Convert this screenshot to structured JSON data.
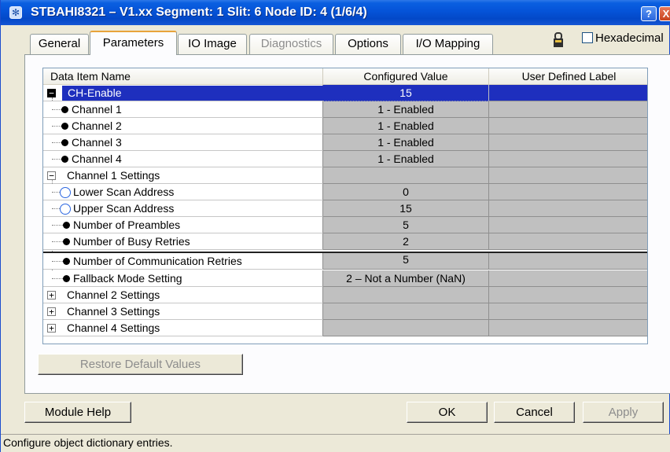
{
  "window": {
    "title": "STBAHI8321 – V1.xx Segment: 1 Slit: 6 Node ID: 4 (1/6/4)",
    "help_glyph": "?",
    "close_glyph": "X"
  },
  "tabs": [
    {
      "label": "General",
      "state": "normal"
    },
    {
      "label": "Parameters",
      "state": "active"
    },
    {
      "label": "IO Image",
      "state": "normal"
    },
    {
      "label": "Diagnostics",
      "state": "disabled"
    },
    {
      "label": "Options",
      "state": "normal"
    },
    {
      "label": "I/O Mapping",
      "state": "normal"
    }
  ],
  "hexadecimal": {
    "label": "Hexadecimal",
    "checked": false
  },
  "grid": {
    "columns": [
      "Data Item Name",
      "Configured Value",
      "User Defined Label"
    ],
    "rows": [
      {
        "name": "CH-Enable",
        "value": "15",
        "label": "",
        "kind": "group",
        "expanded": true,
        "selected": true
      },
      {
        "name": "Channel 1",
        "value": "1 - Enabled",
        "label": "",
        "kind": "item"
      },
      {
        "name": "Channel 2",
        "value": "1 - Enabled",
        "label": "",
        "kind": "item"
      },
      {
        "name": "Channel 3",
        "value": "1 - Enabled",
        "label": "",
        "kind": "item"
      },
      {
        "name": "Channel 4",
        "value": "1 - Enabled",
        "label": "",
        "kind": "item"
      },
      {
        "name": "Channel 1 Settings",
        "value": "",
        "label": "",
        "kind": "group",
        "expanded": true
      },
      {
        "name": "Lower Scan Address",
        "value": "0",
        "label": "",
        "kind": "ring"
      },
      {
        "name": "Upper Scan Address",
        "value": "15",
        "label": "",
        "kind": "ring"
      },
      {
        "name": "Number of Preambles",
        "value": "5",
        "label": "",
        "kind": "item"
      },
      {
        "name": "Number of Busy Retries",
        "value": "2",
        "label": "",
        "kind": "item"
      },
      {
        "name": "Number of Communication Retries",
        "value": "5",
        "label": "",
        "kind": "item"
      },
      {
        "name": "Fallback Mode Setting",
        "value": "2 – Not a Number (NaN)",
        "label": "",
        "kind": "item"
      },
      {
        "name": "Channel 2 Settings",
        "value": "",
        "label": "",
        "kind": "group",
        "expanded": false
      },
      {
        "name": "Channel 3 Settings",
        "value": "",
        "label": "",
        "kind": "group",
        "expanded": false
      },
      {
        "name": "Channel 4 Settings",
        "value": "",
        "label": "",
        "kind": "group",
        "expanded": false
      }
    ]
  },
  "buttons": {
    "restore": "Restore Default Values",
    "module_help": "Module Help",
    "ok": "OK",
    "cancel": "Cancel",
    "apply": "Apply"
  },
  "status_bar": "Configure object dictionary entries.",
  "colors": {
    "selection": "#1e2fbe",
    "title_bar": "#0553d8",
    "cell_gray": "#c0c0c0",
    "ring_blue": "#2b66e0"
  }
}
